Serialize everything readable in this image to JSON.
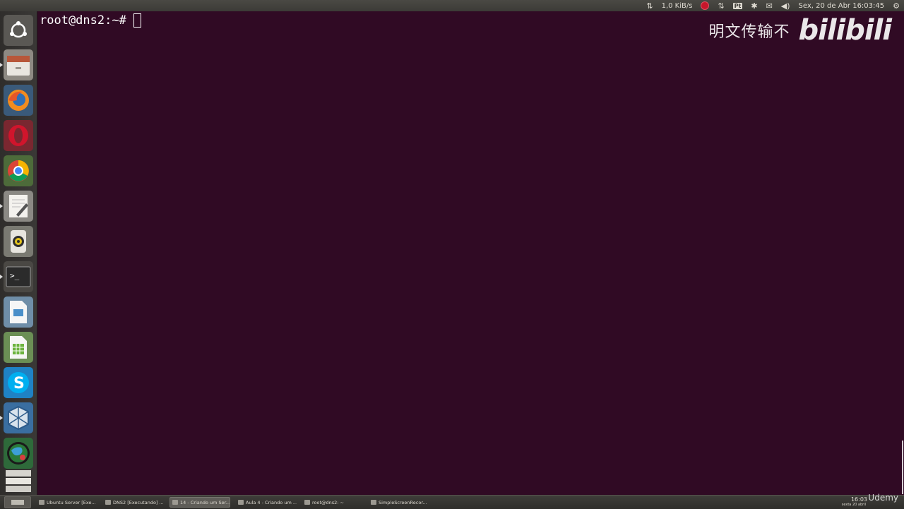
{
  "top_panel": {
    "net_speed": "1,0 KiB/s",
    "keyboard_layout": "Pt",
    "clock": "Sex, 20 de Abr 16:03:45"
  },
  "terminal": {
    "prompt": "root@dns2:~#"
  },
  "watermark": {
    "text_cn": "明文传输不",
    "logo": "bilibili"
  },
  "launcher": {
    "icons": [
      "ubuntu-dash-icon",
      "file-manager-icon",
      "firefox-icon",
      "opera-icon",
      "chrome-icon",
      "text-editor-icon",
      "rhythmbox-icon",
      "terminal-icon",
      "libreoffice-impress-icon",
      "libreoffice-calc-icon",
      "skype-icon",
      "virtualbox-icon",
      "globe-app-icon",
      "workspace-switcher-icon"
    ]
  },
  "taskbar": {
    "tasks": [
      {
        "label": "Ubuntu Server [Exe...",
        "active": false
      },
      {
        "label": "DNS2 [Executando] ...",
        "active": false
      },
      {
        "label": "14 - Criando um Ser...",
        "active": true
      },
      {
        "label": "Aula 4 - Criando um ...",
        "active": false
      },
      {
        "label": "root@dns2: ~",
        "active": false
      },
      {
        "label": "SimpleScreenRecor...",
        "active": false
      }
    ],
    "clock_time": "16:03",
    "clock_date": "sexta 20 abril",
    "watermark_udemy": "Udemy"
  },
  "colors": {
    "terminal_bg": "#300a24",
    "panel_bg": "#3c3b37"
  }
}
